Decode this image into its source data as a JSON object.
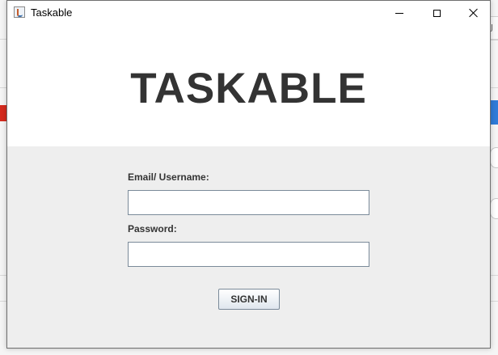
{
  "window": {
    "title": "Taskable",
    "controls": [
      "minimize-icon",
      "maximize-icon",
      "close-icon"
    ]
  },
  "header": {
    "brand": "TASKABLE"
  },
  "form": {
    "email_label": "Email/ Username:",
    "email_value": "",
    "password_label": "Password:",
    "password_value": "",
    "signin_label": "SIGN-IN"
  },
  "background_app": {
    "edge_text": "J"
  },
  "colors": {
    "header_bg": "#ffffff",
    "form_bg": "#eeeeee",
    "brand_text": "#333333",
    "field_border": "#7a8a99"
  }
}
